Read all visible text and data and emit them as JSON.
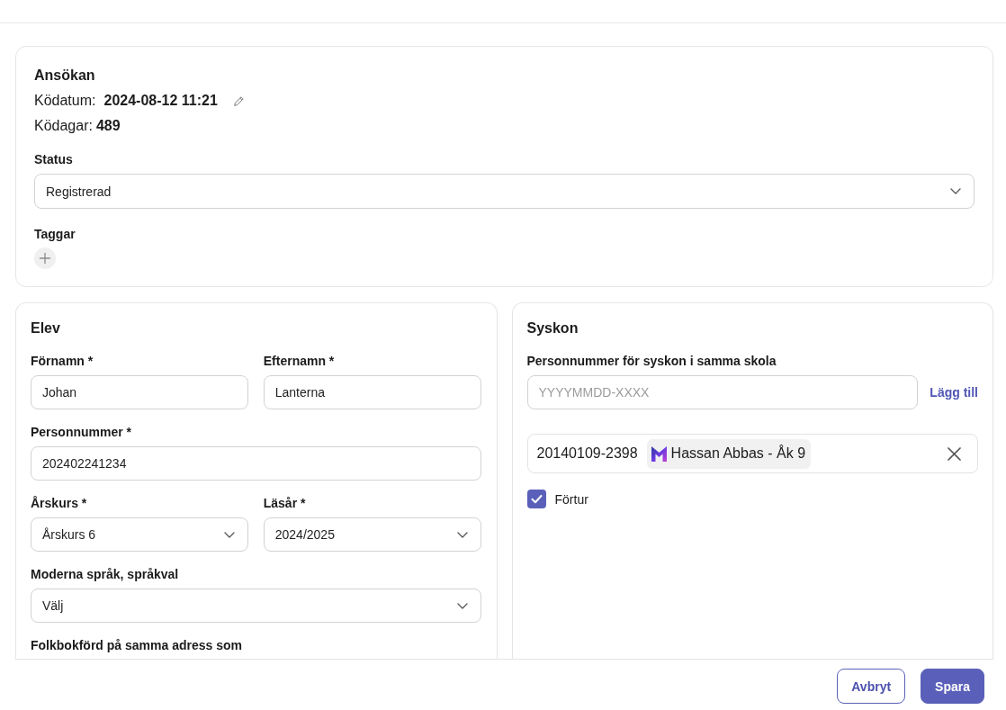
{
  "application": {
    "title": "Ansökan",
    "queue_date": {
      "label": "Ködatum:",
      "value": "2024-08-12 11:21"
    },
    "queue_days": {
      "label": "Ködagar:",
      "value": "489"
    },
    "status": {
      "label": "Status",
      "value": "Registrerad"
    },
    "tags": {
      "label": "Taggar"
    }
  },
  "student": {
    "title": "Elev",
    "rows": [
      [
        {
          "kind": "text",
          "label": "Förnamn *",
          "value": "Johan"
        },
        {
          "kind": "text",
          "label": "Efternamn *",
          "value": "Lanterna"
        }
      ],
      [
        {
          "kind": "text",
          "label": "Personnummer *",
          "value": "202402241234"
        }
      ],
      [
        {
          "kind": "select",
          "label": "Årskurs *",
          "value": "Årskurs 6"
        },
        {
          "kind": "select",
          "label": "Läsår *",
          "value": "2024/2025"
        }
      ],
      [
        {
          "kind": "select",
          "label": "Moderna språk, språkval",
          "value": "Välj"
        }
      ],
      [
        {
          "kind": "group",
          "label": "Folkbokförd på samma adress som"
        }
      ]
    ]
  },
  "siblings": {
    "title": "Syskon",
    "lookup": {
      "label": "Personnummer för syskon i samma skola",
      "placeholder": "YYYYMMDD-XXXX",
      "action": "Lägg till"
    },
    "entries": [
      {
        "personnummer": "20140109-2398",
        "name": "Hassan Abbas - Åk 9"
      }
    ],
    "priority": {
      "label": "Förtur",
      "checked": true
    }
  },
  "footer": {
    "buttons": [
      {
        "kind": "secondary",
        "label": "Avbryt"
      },
      {
        "kind": "primary",
        "label": "Spara"
      }
    ]
  }
}
